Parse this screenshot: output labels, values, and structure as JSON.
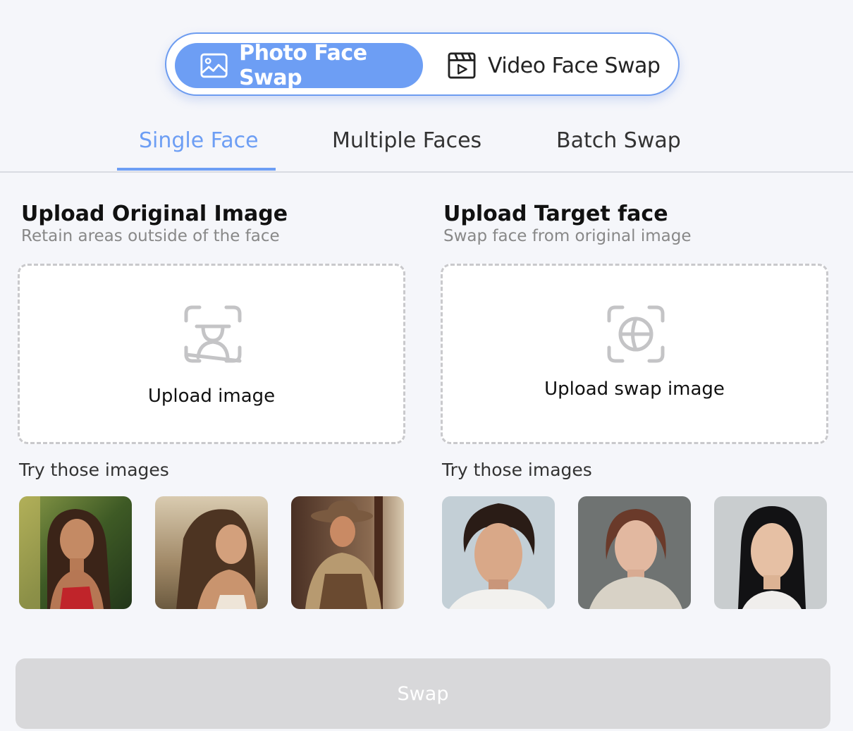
{
  "mode_switch": {
    "photo": {
      "label": "Photo Face Swap",
      "icon": "image-icon",
      "active": true
    },
    "video": {
      "label": "Video Face Swap",
      "icon": "video-clapper-icon",
      "active": false
    }
  },
  "tabs": [
    {
      "label": "Single Face",
      "active": true
    },
    {
      "label": "Multiple Faces",
      "active": false
    },
    {
      "label": "Batch Swap",
      "active": false
    }
  ],
  "original": {
    "title": "Upload Original Image",
    "subtitle": "Retain areas outside of the face",
    "upload_label": "Upload image",
    "icon": "face-scan-icon",
    "try_label": "Try those images"
  },
  "target": {
    "title": "Upload Target face",
    "subtitle": "Swap face from original image",
    "upload_label": "Upload swap image",
    "icon": "face-target-icon",
    "try_label": "Try those images"
  },
  "swap_button": {
    "label": "Swap",
    "enabled": false
  },
  "colors": {
    "accent": "#6d9ef4",
    "background": "#f5f6fa",
    "disabled": "#d8d8da",
    "muted_text": "#888888"
  }
}
